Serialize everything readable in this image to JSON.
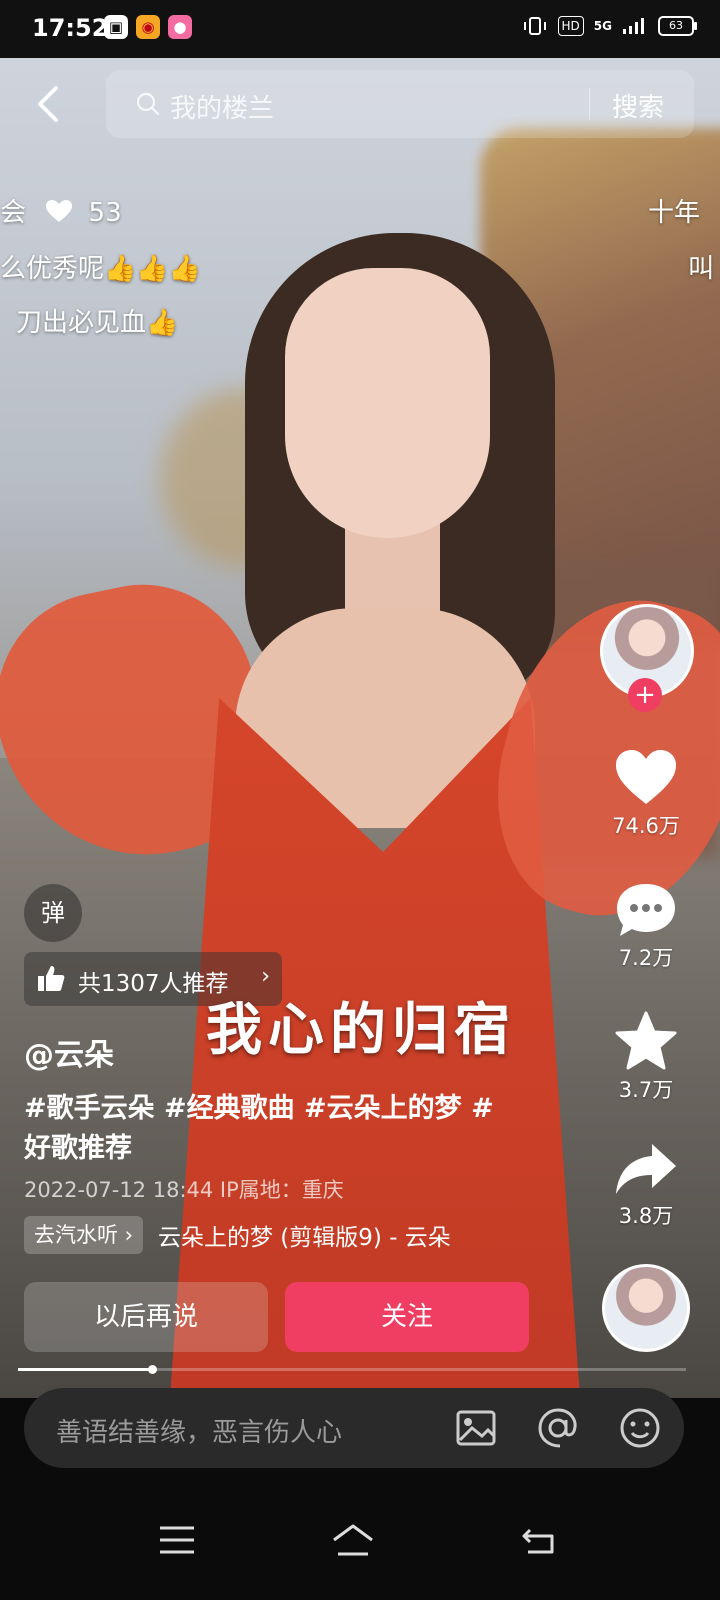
{
  "status_bar": {
    "time": "17:52",
    "battery": "63",
    "hd_badge": "HD",
    "network": "5G"
  },
  "search": {
    "placeholder": "我的楼兰",
    "button_label": "搜索"
  },
  "danmaku": [
    "会",
    "53",
    "么优秀呢👍👍👍",
    "刀出必见血👍",
    "十年",
    "叫"
  ],
  "video_overlay": {
    "danmaku_toggle": "弹",
    "recommend_label": "共1307人推荐",
    "lyrics": "我心的归宿"
  },
  "actions": {
    "likes": "74.6万",
    "comments": "7.2万",
    "favorites": "3.7万",
    "shares": "3.8万"
  },
  "post": {
    "author": "@云朵",
    "description_line1": "#歌手云朵 #经典歌曲 #云朵上的梦 #",
    "description_line2": "好歌推荐",
    "date_location": "2022-07-12 18:44  IP属地：重庆",
    "music_chip": "去汽水听 ›",
    "music_title": "云朵上的梦 (剪辑版9) - 云朵"
  },
  "buttons": {
    "later": "以后再说",
    "follow": "关注"
  },
  "progress": {
    "played_fraction": 0.2
  },
  "comment_bar": {
    "placeholder": "善语结善缘，恶言伤人心"
  },
  "colors": {
    "accent": "#f03d62"
  }
}
